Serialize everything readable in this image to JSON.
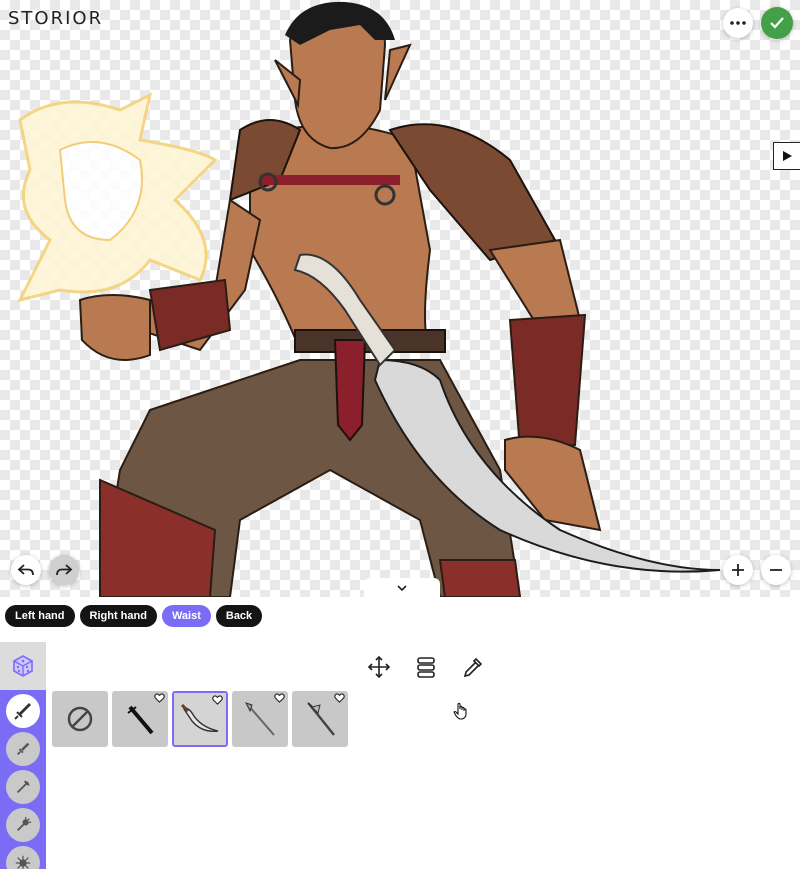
{
  "app": {
    "logo": "STORIOR"
  },
  "canvas": {
    "buttons": {
      "more": "more-icon",
      "confirm": "check-icon",
      "preview": "play-icon",
      "undo": "undo-icon",
      "redo": "redo-icon",
      "zoom_in": "plus-icon",
      "zoom_out": "minus-icon",
      "collapse": "chevron-down-icon"
    }
  },
  "slots": {
    "items": [
      {
        "label": "Left hand",
        "active": false
      },
      {
        "label": "Right hand",
        "active": false
      },
      {
        "label": "Waist",
        "active": true
      },
      {
        "label": "Back",
        "active": false
      }
    ]
  },
  "tools": [
    "move-icon",
    "layers-icon",
    "eyedropper-icon"
  ],
  "categories": {
    "randomize": "dice-icon",
    "items": [
      "sword-icon",
      "dagger-icon",
      "axe-icon",
      "mace-icon",
      "morningstar-icon"
    ],
    "active_index": 0
  },
  "gallery": {
    "items": [
      {
        "name": "none-icon",
        "selected": false,
        "favorite": false
      },
      {
        "name": "black-sword-icon",
        "selected": false,
        "favorite": true
      },
      {
        "name": "curved-scimitar-icon",
        "selected": true,
        "favorite": true
      },
      {
        "name": "spear-icon",
        "selected": false,
        "favorite": true
      },
      {
        "name": "halberd-icon",
        "selected": false,
        "favorite": true
      }
    ]
  },
  "colors": {
    "accent": "#7b6cf6",
    "confirm": "#43a047",
    "tab_dark": "#141414"
  }
}
